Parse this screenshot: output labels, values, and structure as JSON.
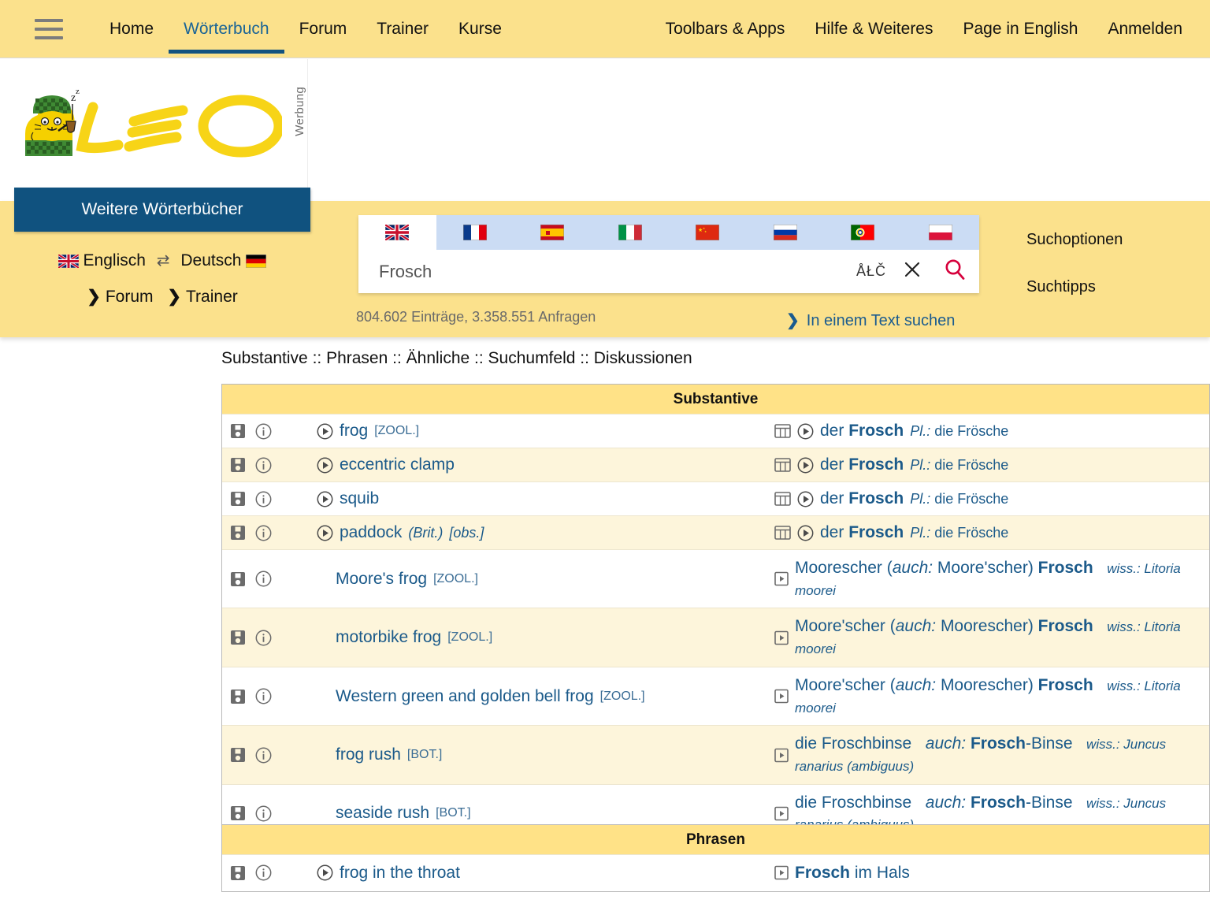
{
  "nav": {
    "menu_icon": "hamburger-icon",
    "left_items": [
      {
        "label": "Home",
        "active": false
      },
      {
        "label": "Wörterbuch",
        "active": true
      },
      {
        "label": "Forum",
        "active": false
      },
      {
        "label": "Trainer",
        "active": false
      },
      {
        "label": "Kurse",
        "active": false
      }
    ],
    "right_items": [
      {
        "label": "Toolbars & Apps"
      },
      {
        "label": "Hilfe & Weiteres"
      },
      {
        "label": "Page in English"
      },
      {
        "label": "Anmelden"
      }
    ]
  },
  "brand": {
    "logo_text": "LEO",
    "ad_label": "Werbung"
  },
  "sidebar": {
    "more_dicts_label": "Weitere Wörterbücher",
    "lang_from": "Englisch",
    "lang_to": "Deutsch",
    "swap_icon": "swap-arrows-icon",
    "flag_from": "uk-flag-icon",
    "flag_to": "germany-flag-icon",
    "links": [
      {
        "label": "Forum"
      },
      {
        "label": "Trainer"
      }
    ]
  },
  "search": {
    "value": "Frosch",
    "placeholder": "Frosch",
    "special_chars_label": "ÅŁČ",
    "clear_icon": "close-icon",
    "search_icon": "search-icon",
    "language_tabs": [
      {
        "name": "english",
        "icon": "uk-flag-icon",
        "active": true
      },
      {
        "name": "french",
        "icon": "france-flag-icon",
        "active": false
      },
      {
        "name": "spanish",
        "icon": "spain-flag-icon",
        "active": false
      },
      {
        "name": "italian",
        "icon": "italy-flag-icon",
        "active": false
      },
      {
        "name": "chinese",
        "icon": "china-flag-icon",
        "active": false
      },
      {
        "name": "russian",
        "icon": "russia-flag-icon",
        "active": false
      },
      {
        "name": "portuguese",
        "icon": "portugal-flag-icon",
        "active": false
      },
      {
        "name": "polish",
        "icon": "poland-flag-icon",
        "active": false
      }
    ],
    "stats": "804.602 Einträge, 3.358.551 Anfragen",
    "text_search_label": "In einem Text suchen",
    "options_label": "Suchoptionen",
    "tips_label": "Suchtipps"
  },
  "results": {
    "breadcrumb": "Substantive :: Phrasen :: Ähnliche :: Suchumfeld :: Diskussionen",
    "sections": [
      {
        "title": "Substantive",
        "rows": [
          {
            "style": "compact",
            "left": {
              "play": true,
              "term": "frog",
              "tag": "[ZOOL.]"
            },
            "right": {
              "cols": true,
              "play": true,
              "article": "der ",
              "headword": "Frosch",
              "plural_label": "Pl.:",
              "plural": "die Frösche"
            }
          },
          {
            "style": "compact",
            "left": {
              "play": true,
              "term": "eccentric clamp",
              "tag": ""
            },
            "right": {
              "cols": true,
              "play": true,
              "article": "der ",
              "headword": "Frosch",
              "plural_label": "Pl.:",
              "plural": "die Frösche"
            }
          },
          {
            "style": "compact",
            "left": {
              "play": true,
              "term": "squib",
              "tag": ""
            },
            "right": {
              "cols": true,
              "play": true,
              "article": "der ",
              "headword": "Frosch",
              "plural_label": "Pl.:",
              "plural": "die Frösche"
            }
          },
          {
            "style": "compact",
            "left": {
              "play": true,
              "term": "paddock",
              "tag_italic": "(Brit.)",
              "tag_obs": "[obs.]"
            },
            "right": {
              "cols": true,
              "play": true,
              "article": "der ",
              "headword": "Frosch",
              "plural_label": "Pl.:",
              "plural": "die Frösche"
            }
          },
          {
            "style": "tall",
            "left": {
              "play": false,
              "term": "Moore's frog",
              "tag": "[ZOOL.]"
            },
            "right": {
              "playbox": true,
              "main": "Moorescher ",
              "paren_open": "(",
              "paren_it": "auch:",
              "paren_rest": " Moore'scher)",
              "headword": " Frosch",
              "sci": "wiss.: Litoria moorei"
            }
          },
          {
            "style": "tall",
            "left": {
              "play": false,
              "term": "motorbike frog",
              "tag": "[ZOOL.]"
            },
            "right": {
              "playbox": true,
              "main": "Moore'scher ",
              "paren_open": "(",
              "paren_it": "auch:",
              "paren_rest": " Moorescher)",
              "headword": " Frosch",
              "sci": "wiss.: Litoria moorei"
            }
          },
          {
            "style": "tall",
            "left": {
              "play": false,
              "term": "Western green and golden bell frog",
              "tag": "[ZOOL.]"
            },
            "right": {
              "playbox": true,
              "main": "Moore'scher ",
              "paren_open": "(",
              "paren_it": "auch:",
              "paren_rest": " Moorescher)",
              "headword": " Frosch",
              "sci": "wiss.: Litoria moorei"
            }
          },
          {
            "style": "tall",
            "left": {
              "play": false,
              "term": "frog rush",
              "tag": "[BOT.]"
            },
            "right": {
              "playbox": true,
              "main": "die Froschbinse",
              "alt_it": "auch:",
              "alt_bold": "Frosch",
              "alt_rest": "-Binse",
              "sci": "wiss.: Juncus ranarius (ambiguus)"
            }
          },
          {
            "style": "tall",
            "left": {
              "play": false,
              "term": "seaside rush",
              "tag": "[BOT.]"
            },
            "right": {
              "playbox": true,
              "main": "die Froschbinse",
              "alt_it": "auch:",
              "alt_bold": "Frosch",
              "alt_rest": "-Binse",
              "sci": "wiss.: Juncus ranarius (ambiguus)"
            }
          }
        ]
      },
      {
        "title": "Phrasen",
        "rows": [
          {
            "style": "compact",
            "left": {
              "play": true,
              "term": "frog in the throat",
              "tag": ""
            },
            "right": {
              "playbox": true,
              "headword": "Frosch",
              "rest": " im Hals"
            }
          }
        ]
      }
    ]
  },
  "colors": {
    "banner_yellow": "#FBE18C",
    "table_header_yellow": "#FFE287",
    "row_alt": "#FDF5DB",
    "link_blue": "#1b5a8a",
    "accent_blue": "#10527F",
    "search_red": "#D6003C"
  }
}
